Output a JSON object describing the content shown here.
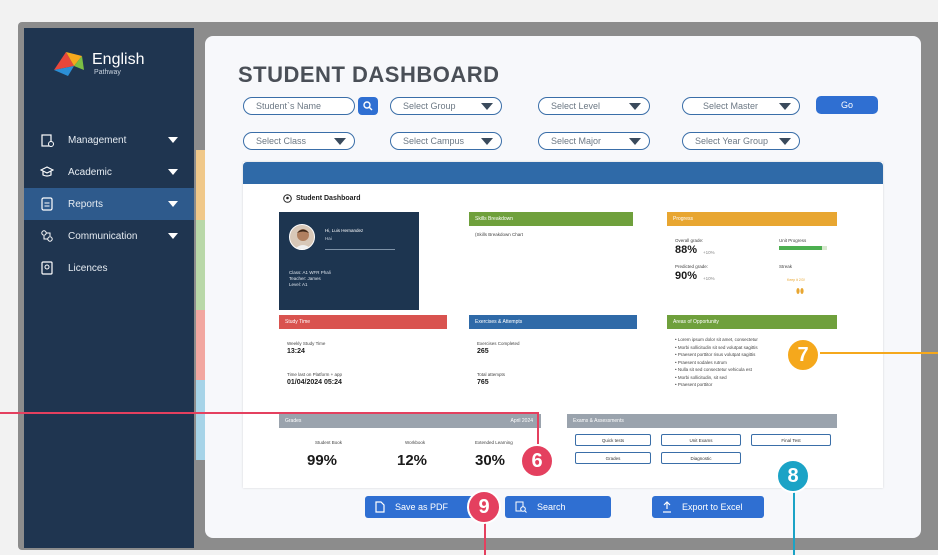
{
  "logo": {
    "title": "English",
    "subtitle": "Pathway"
  },
  "nav": [
    {
      "label": "Management",
      "has_caret": true
    },
    {
      "label": "Academic",
      "has_caret": true
    },
    {
      "label": "Reports",
      "has_caret": true,
      "active": true
    },
    {
      "label": "Communication",
      "has_caret": true
    },
    {
      "label": "Licences",
      "has_caret": false
    }
  ],
  "page_title": "STUDENT DASHBOARD",
  "filters": {
    "student_name": "Student`s Name",
    "group": "Select Group",
    "level": "Select Level",
    "master": "Select Master",
    "go": "Go",
    "class": "Select Class",
    "campus": "Select Campus",
    "major": "Select Major",
    "year_group": "Select Year Group"
  },
  "report": {
    "title": "Student Dashboard",
    "profile": {
      "name": "Hi, Luis Hernandez",
      "sub": "Hai",
      "line1": "Class: A1 WFR Phali",
      "line2": "Teacher: James",
      "line3": "Level: A1"
    },
    "skills": {
      "header": "Skills Breakdown",
      "body": "(Skills Breakdown Chart"
    },
    "progress": {
      "header": "Progress",
      "overall_label": "Overall grade:",
      "overall_value": "88%",
      "overall_suffix": "+10%",
      "predicted_label": "Predicted grade:",
      "predicted_value": "90%",
      "predicted_suffix": "+10%",
      "unit_label": "Unit Progress",
      "streak_label": "Streak",
      "streak_note": "Keep it 2/3!",
      "unit_progress": 0.9
    },
    "study_time": {
      "header": "Study Time",
      "weekly_label": "Weekly Study Time",
      "weekly_value": "13:24",
      "last_label": "Time last on Platform + app",
      "last_value": "01/04/2024 05:24"
    },
    "exercises": {
      "header": "Exercises & Attempts",
      "completed_label": "Exercises Completed",
      "completed_value": "265",
      "attempts_label": "Total attempts",
      "attempts_value": "765"
    },
    "areas": {
      "header": "Areas of Opportunity",
      "items": [
        "Lorem ipsum dolor sit amet, consectetur",
        "Morbi sollicitudin sit sed volutpat sagittis",
        "Praesent porttitor risus volutpat sagittis",
        "Praesent sodales rutrum",
        "Nulla sit sed consectetur vehicula est",
        "Morbi sollicitudin, sit sed",
        "Praesent porttitor"
      ]
    },
    "grades": {
      "header": "Grades",
      "period": "April 2024",
      "labels": [
        "Student Book",
        "Workbook",
        "Extended Learning"
      ],
      "values": [
        "99%",
        "12%",
        "30%"
      ]
    },
    "exams": {
      "header": "Exams & Assessments",
      "chips": [
        "Quick tests",
        "Unit Exams",
        "Final Test",
        "Grades",
        "Diagnostic"
      ]
    }
  },
  "actions": {
    "save_pdf": "Save as PDF",
    "search": "Search",
    "export": "Export to Excel"
  },
  "callouts": [
    "6",
    "7",
    "8",
    "9"
  ],
  "colors": {
    "sidebar": "#1f3550",
    "accent": "#2f6fd2",
    "callout_6": "#e4405f",
    "callout_7": "#f5a81c",
    "callout_8": "#1ba3c6",
    "callout_9": "#e4405f"
  }
}
